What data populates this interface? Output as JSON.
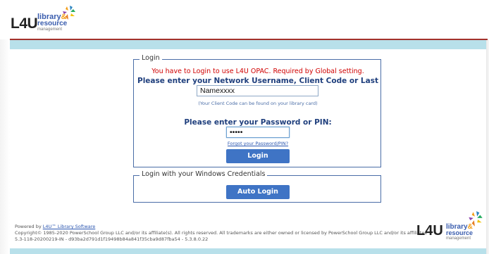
{
  "header": {
    "logo": {
      "mark": "L4U",
      "line1": "library",
      "amp": "&",
      "line2": "resource",
      "line3": "management"
    }
  },
  "login": {
    "legend": "Login",
    "required_message": "You have to Login to use L4U OPAC. Required by Global setting.",
    "username_prompt": "Please enter your Network Username, Client Code or Last Name:",
    "username_value": "Namexxxx",
    "client_code_hint": "(Your Client Code can be found on your library card)",
    "password_prompt": "Please enter your Password or PIN:",
    "password_value": "•••••",
    "forgot_link": "Forgot your Password/PIN?",
    "login_button": "Login"
  },
  "windows_login": {
    "legend": "Login with your Windows Credentials",
    "auto_login_button": "Auto Login"
  },
  "footer": {
    "powered_prefix": "Powered by ",
    "powered_link": "L4U™ Library Software",
    "copyright": "Copyright© 1985-2020 PowerSchool Group LLC and/or its affiliate(s). All rights reserved. All trademarks are either owned or licensed by PowerSchool Group LLC and/or its affiliates",
    "version": "5.3-118-20200219-IN - d93ba2d791d1f19498b84a841f35cba9d87fba54 - 5.3.8.0.22",
    "logo": {
      "mark": "L4U",
      "line1": "library",
      "amp": "&",
      "line2": "resource",
      "line3": "management"
    }
  },
  "colors": {
    "accent_red": "#a3322c",
    "bar_blue": "#b8e0ea",
    "button_blue": "#3f74c5",
    "prompt_navy": "#1f3f7d",
    "error_red": "#d00000"
  }
}
